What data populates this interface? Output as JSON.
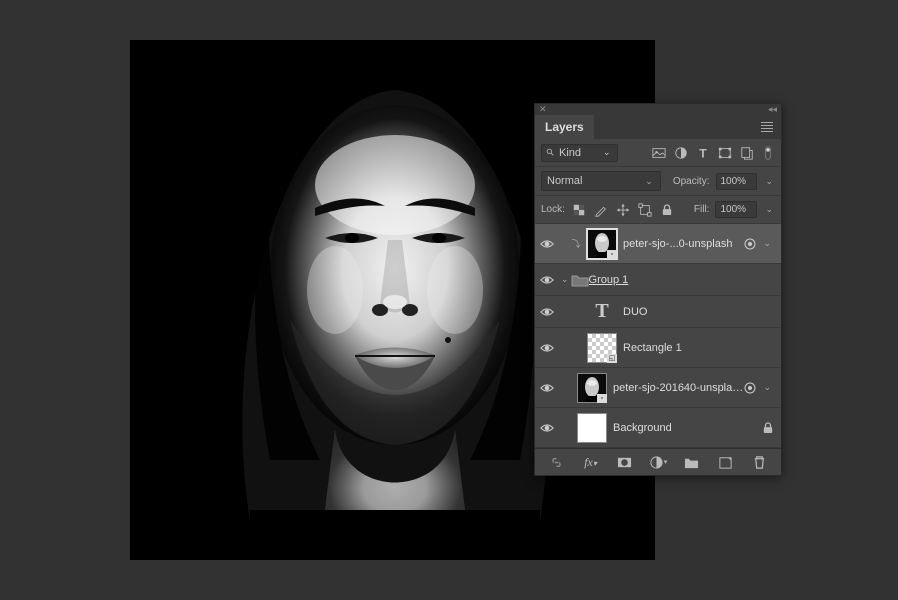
{
  "panel": {
    "tab": "Layers",
    "filter": {
      "label": "Kind"
    },
    "blend": {
      "mode": "Normal",
      "opacity_label": "Opacity:",
      "opacity_value": "100%"
    },
    "lock": {
      "label": "Lock:",
      "fill_label": "Fill:",
      "fill_value": "100%"
    },
    "layers": [
      {
        "name": "peter-sjo-...0-unsplash",
        "selected": true,
        "smart": true,
        "clipped": true
      },
      {
        "name": "Group 1",
        "group": true
      },
      {
        "name": "DUO",
        "text": true
      },
      {
        "name": "Rectangle 1",
        "shape": true
      },
      {
        "name": "peter-sjo-201640-unsplash",
        "smart": true
      },
      {
        "name": "Background",
        "locked": true,
        "bg": true
      }
    ]
  }
}
